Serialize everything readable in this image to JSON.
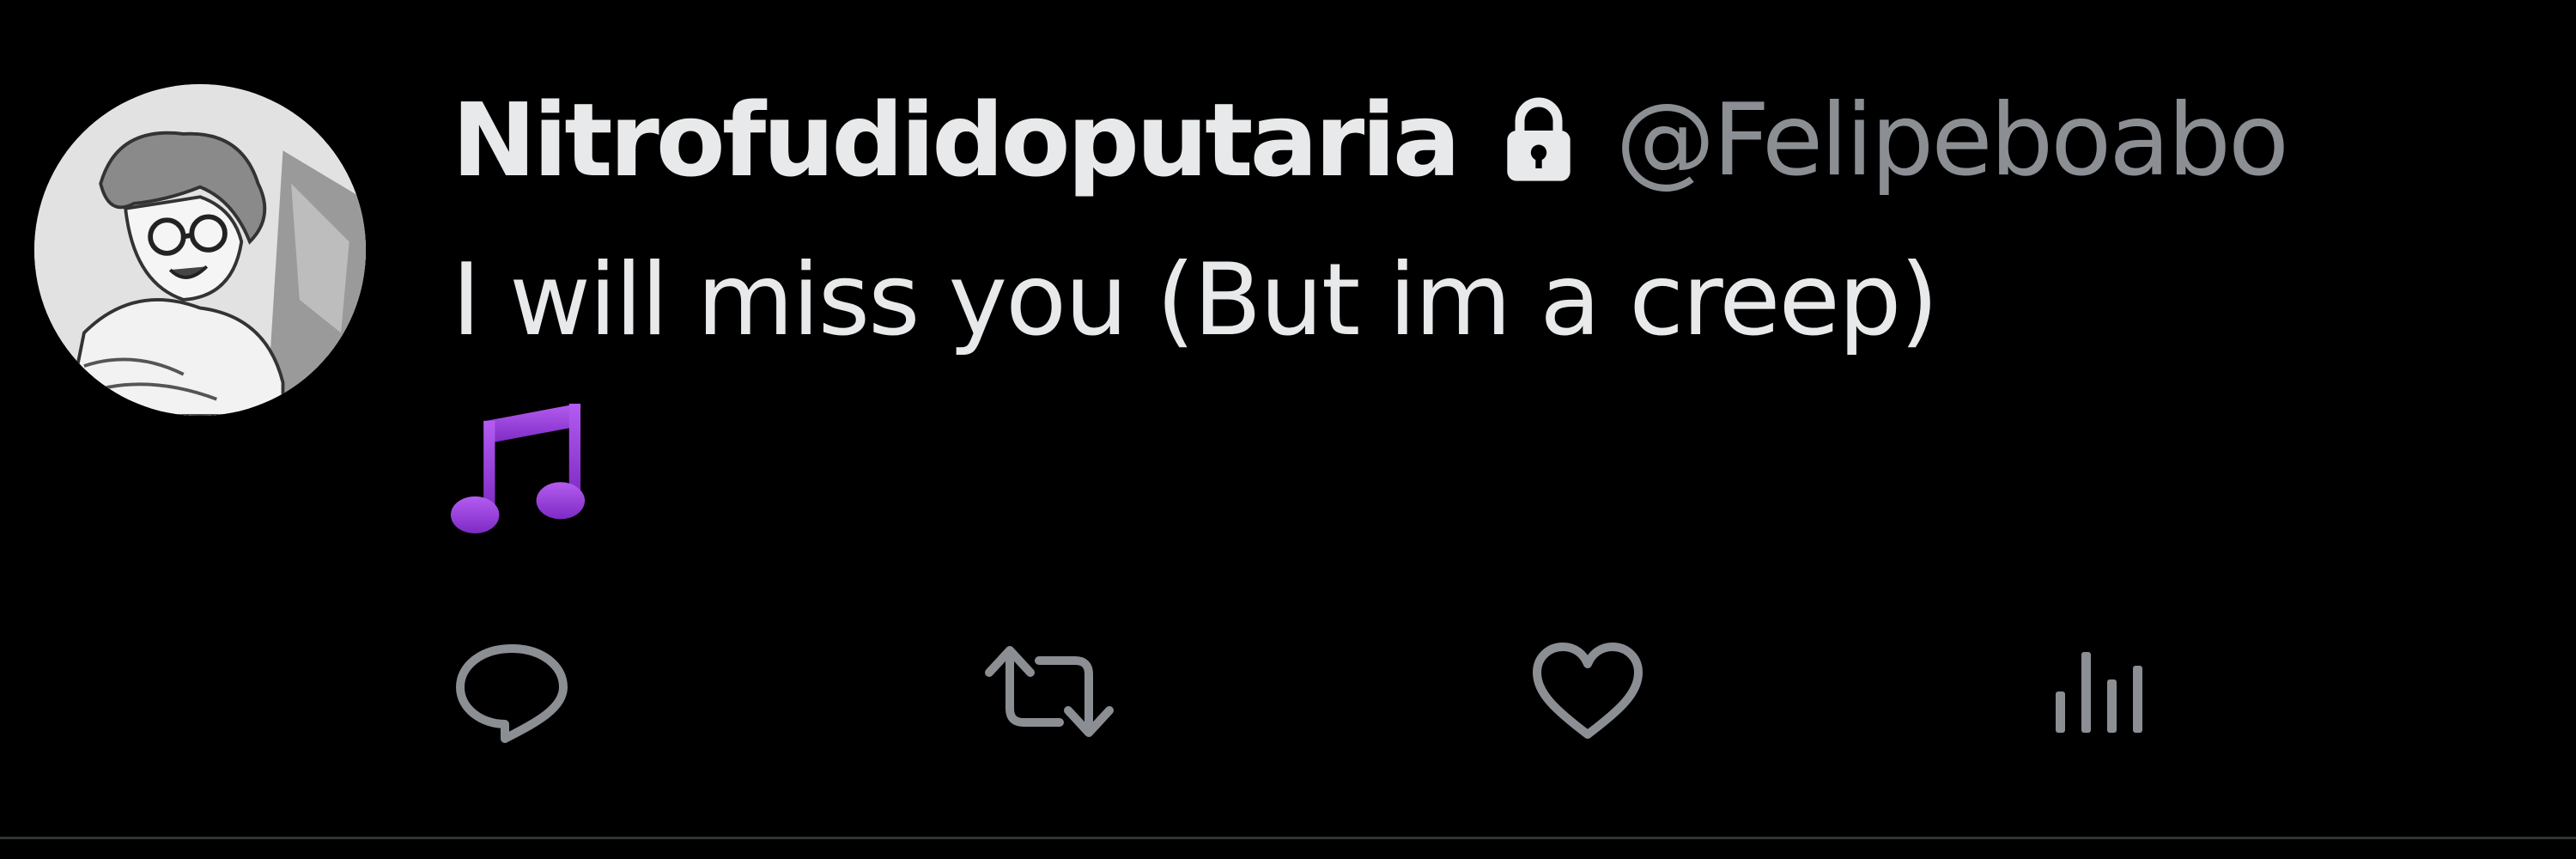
{
  "tweet": {
    "author": {
      "display_name": "Nitrofudidoputaria",
      "handle": "@Felipeboabo",
      "protected_icon": "lock-icon",
      "avatar_icon": "avatar"
    },
    "text": "I will miss you (But im a creep)",
    "emoji": "music-notes-icon",
    "actions": [
      {
        "name": "reply",
        "icon": "reply-icon"
      },
      {
        "name": "retweet",
        "icon": "retweet-icon"
      },
      {
        "name": "like",
        "icon": "heart-icon"
      },
      {
        "name": "views",
        "icon": "views-icon"
      }
    ]
  },
  "colors": {
    "background": "#000000",
    "primary_text": "#e7e9ea",
    "secondary_text": "#8b8f94",
    "emoji_purple": "#9b3fd6",
    "divider": "#2f3336"
  }
}
